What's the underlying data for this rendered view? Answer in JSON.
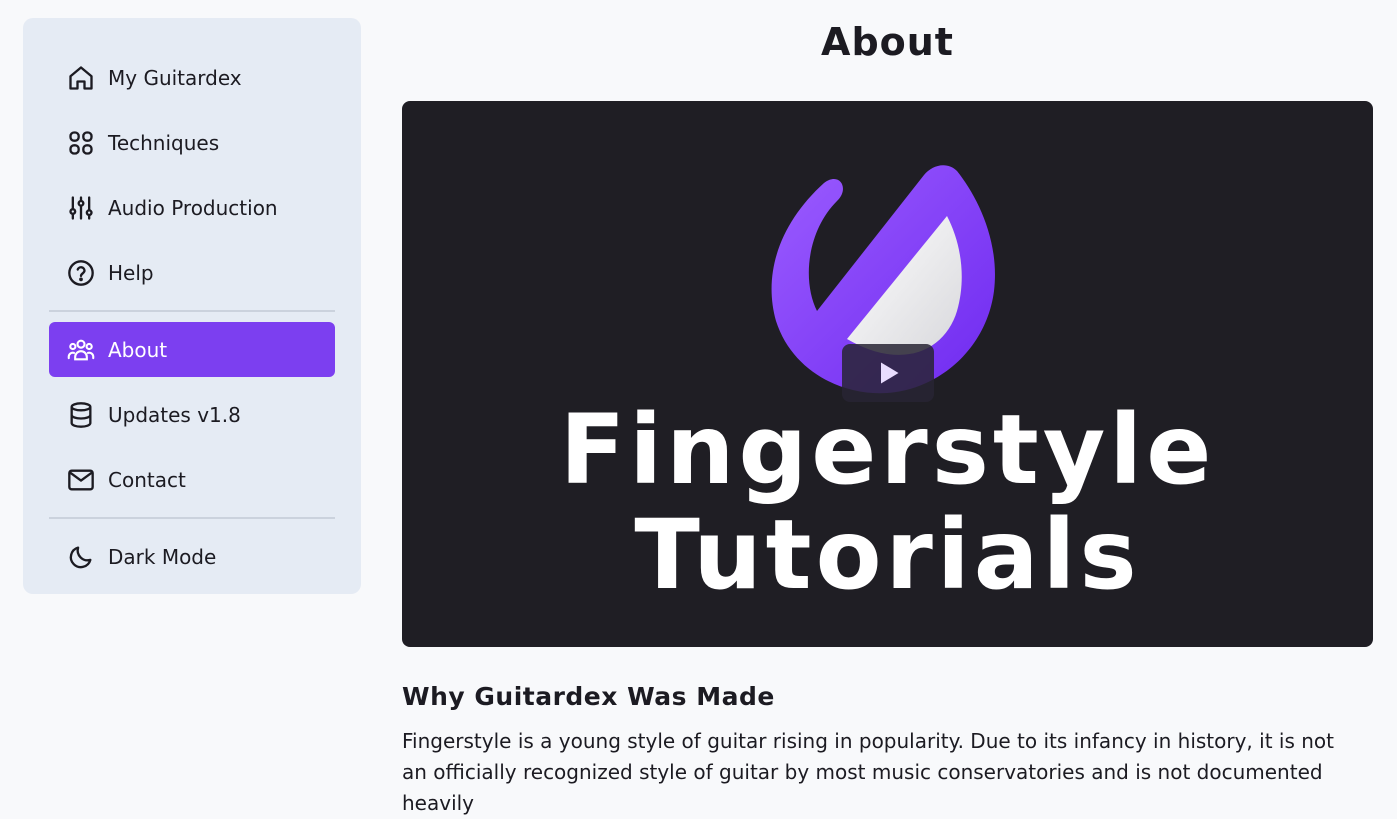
{
  "sidebar": {
    "items": [
      {
        "label": "My Guitardex",
        "icon": "home-icon"
      },
      {
        "label": "Techniques",
        "icon": "grid-icon"
      },
      {
        "label": "Audio Production",
        "icon": "sliders-icon"
      },
      {
        "label": "Help",
        "icon": "help-circle-icon"
      },
      {
        "label": "About",
        "icon": "users-icon",
        "active": true
      },
      {
        "label": "Updates v1.8",
        "icon": "database-icon"
      },
      {
        "label": "Contact",
        "icon": "mail-icon"
      },
      {
        "label": "Dark Mode",
        "icon": "moon-icon"
      }
    ]
  },
  "main": {
    "title": "About",
    "video": {
      "title_line1": "Fingerstyle",
      "title_line2": "Tutorials"
    },
    "section_heading": "Why Guitardex Was Made",
    "body": "Fingerstyle is a young style of guitar rising in popularity. Due to its infancy in history, it is not an officially recognized style of guitar by most music conservatories and is not documented heavily"
  },
  "colors": {
    "accent": "#7c3ff0",
    "sidebar_bg": "#e5ebf4",
    "video_bg": "#1f1e24"
  }
}
